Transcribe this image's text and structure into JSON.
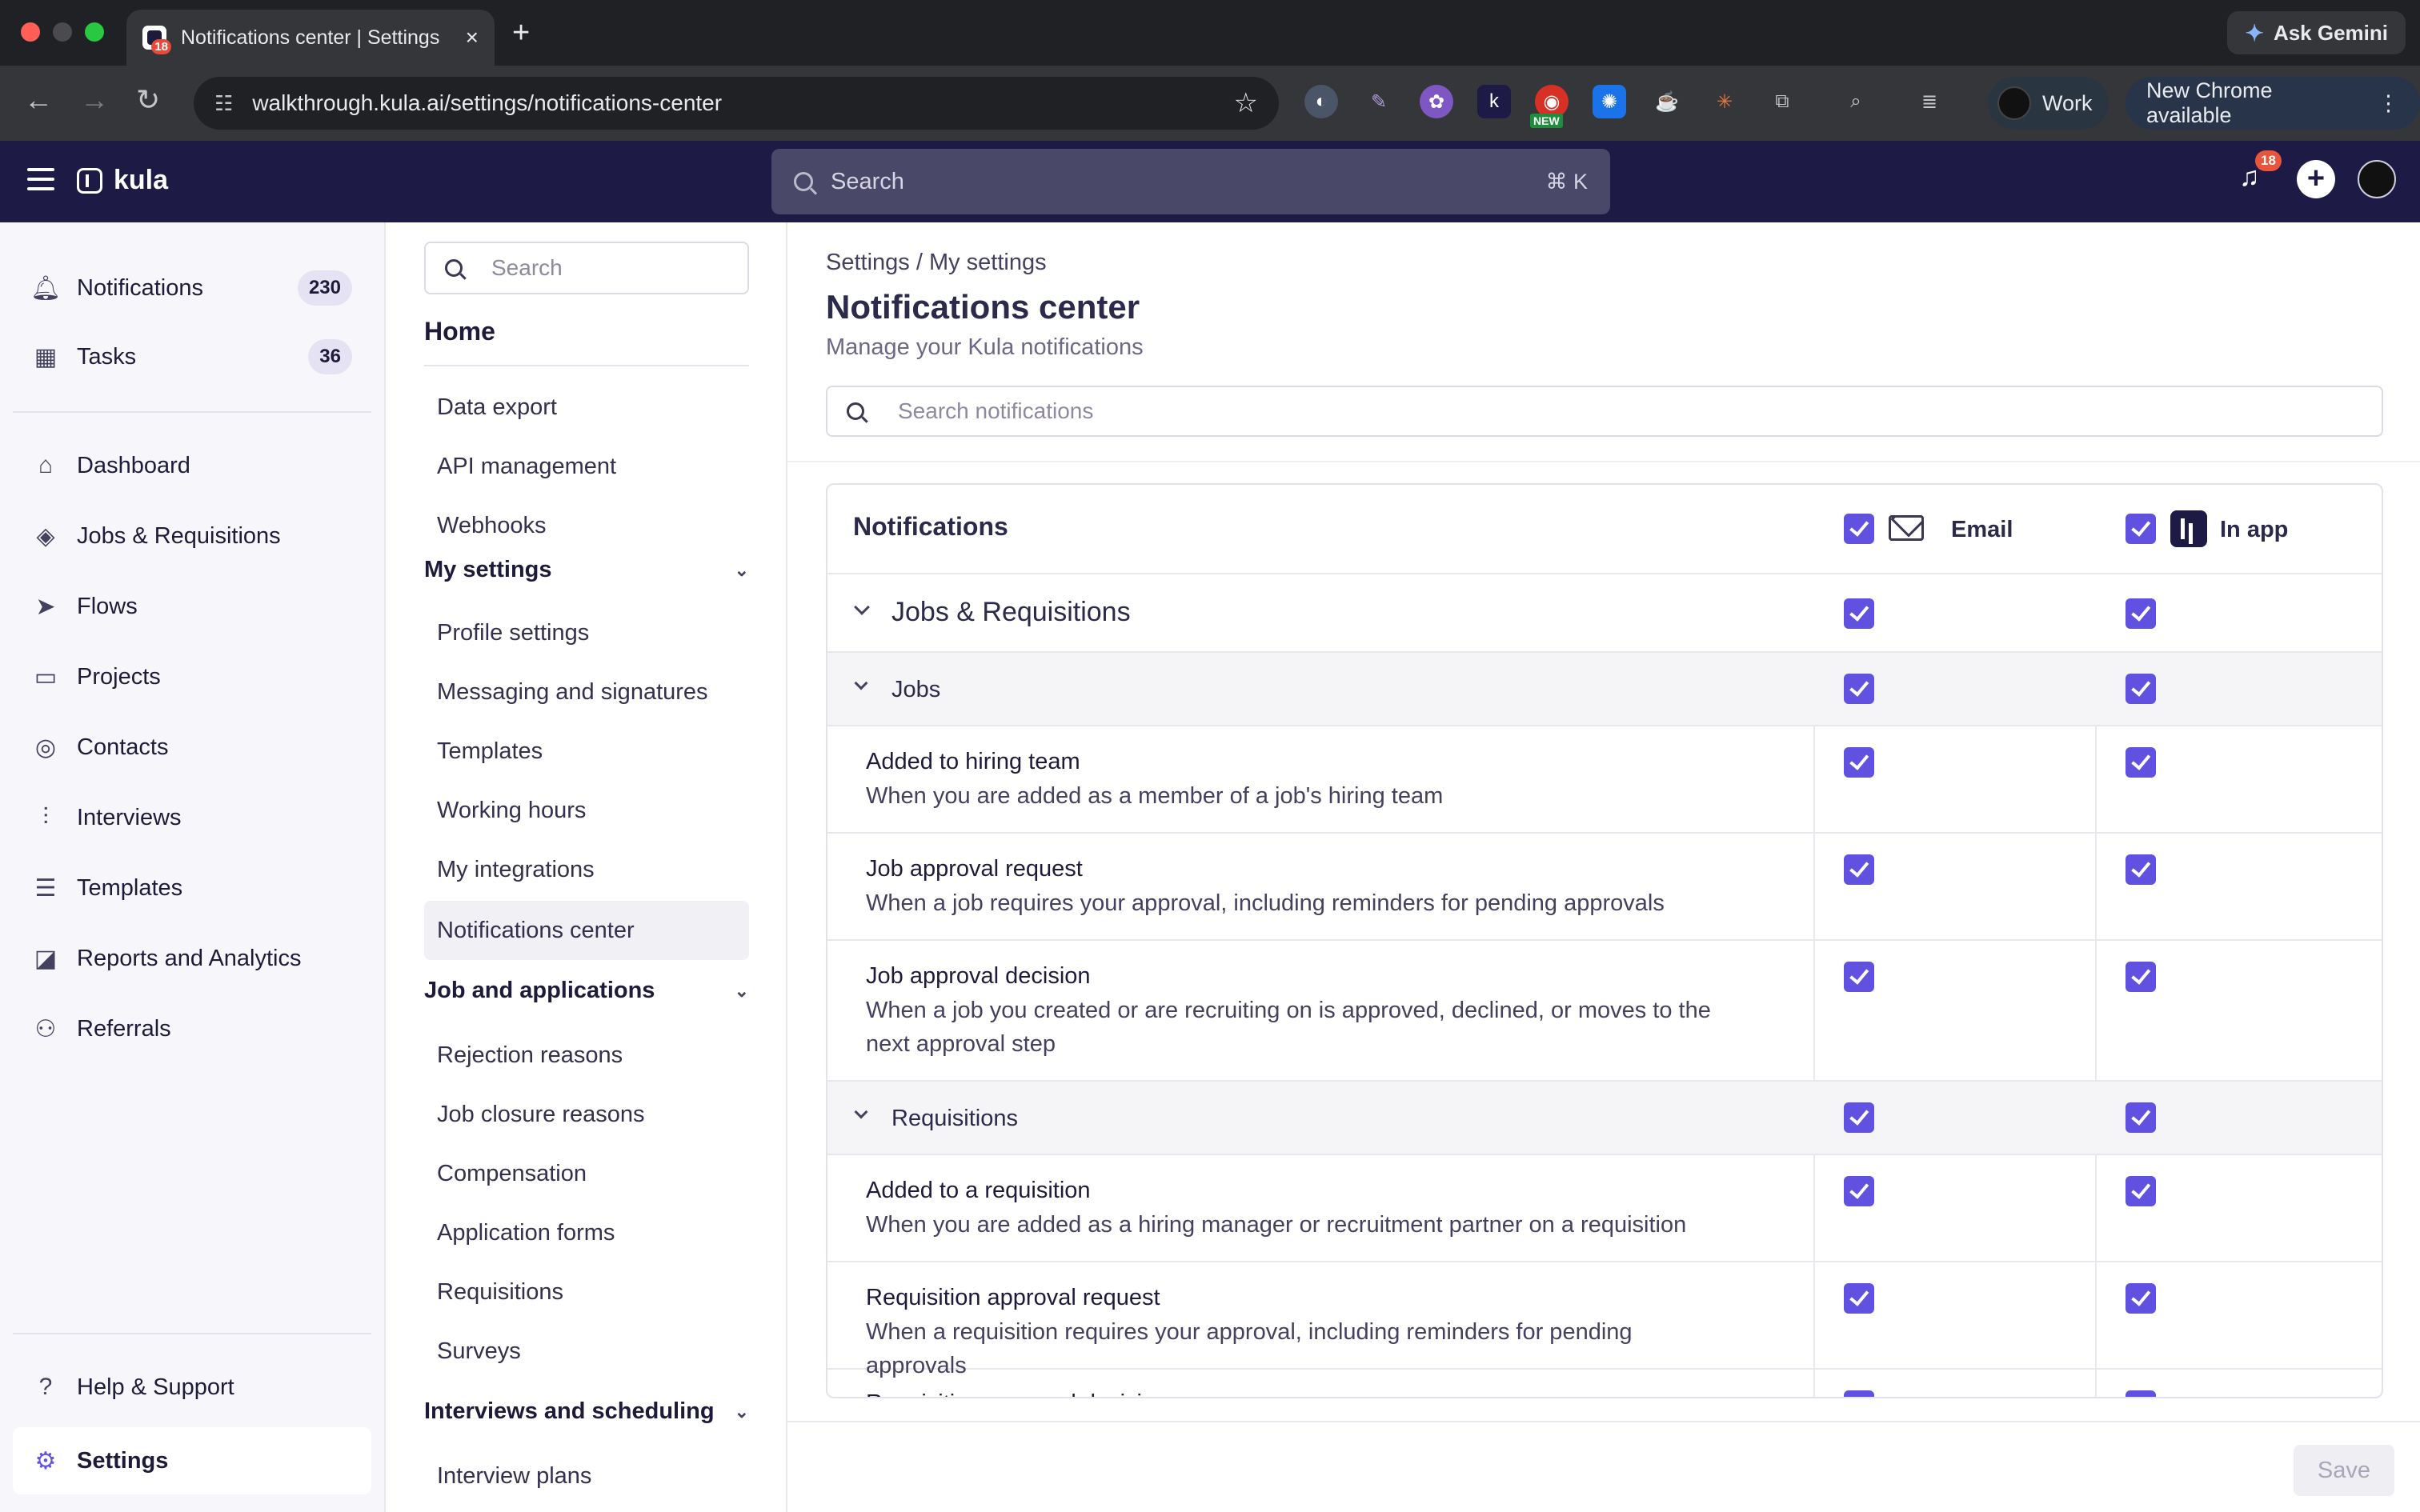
{
  "browser": {
    "tab_title": "Notifications center | Settings",
    "tab_badge": "18",
    "url": "walkthrough.kula.ai/settings/notifications-center",
    "gemini_label": "Ask Gemini",
    "profile_label": "Work",
    "update_label": "New Chrome available",
    "new_badge": "NEW"
  },
  "appbar": {
    "brand": "kula",
    "search_placeholder": "Search",
    "search_shortcut": "⌘ K",
    "feed_count": "18"
  },
  "leftnav": {
    "items": [
      {
        "label": "Notifications",
        "count": "230",
        "icon": "bell-icon"
      },
      {
        "label": "Tasks",
        "count": "36",
        "icon": "calendar-icon"
      },
      {
        "label": "Dashboard",
        "icon": "home-icon"
      },
      {
        "label": "Jobs & Requisitions",
        "icon": "layers-icon"
      },
      {
        "label": "Flows",
        "icon": "send-icon"
      },
      {
        "label": "Projects",
        "icon": "folder-icon"
      },
      {
        "label": "Contacts",
        "icon": "contact-icon"
      },
      {
        "label": "Interviews",
        "icon": "waveform-icon"
      },
      {
        "label": "Templates",
        "icon": "document-icon"
      },
      {
        "label": "Reports and Analytics",
        "icon": "chart-icon"
      },
      {
        "label": "Referrals",
        "icon": "users-icon"
      },
      {
        "label": "Help & Support",
        "icon": "help-icon"
      },
      {
        "label": "Settings",
        "icon": "gear-icon"
      }
    ]
  },
  "subnav": {
    "search_placeholder": "Search",
    "home": "Home",
    "home_items": [
      "Data export",
      "API management",
      "Webhooks"
    ],
    "my_settings": "My settings",
    "my_settings_items": [
      "Profile settings",
      "Messaging and signatures",
      "Templates",
      "Working hours",
      "My integrations",
      "Notifications center"
    ],
    "job_apps": "Job and applications",
    "job_apps_items": [
      "Rejection reasons",
      "Job closure reasons",
      "Compensation",
      "Application forms",
      "Requisitions",
      "Surveys"
    ],
    "interviews": "Interviews and scheduling",
    "interviews_items": [
      "Interview plans"
    ]
  },
  "main": {
    "breadcrumb": "Settings / My settings",
    "title": "Notifications center",
    "subtitle": "Manage your Kula notifications",
    "search_placeholder": "Search notifications",
    "table": {
      "header": "Notifications",
      "email_label": "Email",
      "inapp_label": "In app",
      "section": "Jobs & Requisitions",
      "group_jobs": "Jobs",
      "jobs_items": [
        {
          "title": "Added to hiring team",
          "desc": "When you are added as a member of a job's hiring team",
          "email": true,
          "inapp": true
        },
        {
          "title": "Job approval request",
          "desc": "When a job requires your approval, including reminders for pending approvals",
          "email": true,
          "inapp": true
        },
        {
          "title": "Job approval decision",
          "desc": "When a job you created or are recruiting on is approved, declined, or moves to the next approval step",
          "email": true,
          "inapp": true
        }
      ],
      "group_reqs": "Requisitions",
      "req_items": [
        {
          "title": "Added to a requisition",
          "desc": "When you are added as a hiring manager or recruitment partner on a requisition",
          "email": true,
          "inapp": true
        },
        {
          "title": "Requisition approval request",
          "desc": "When a requisition requires your approval, including reminders for pending approvals",
          "email": true,
          "inapp": true
        },
        {
          "title": "Requisition approval decision",
          "desc": "",
          "email": true,
          "inapp": true
        }
      ]
    },
    "save_label": "Save"
  },
  "colors": {
    "accent": "#6151e0",
    "appbar": "#1d1a45",
    "browser_dark": "#202124"
  }
}
